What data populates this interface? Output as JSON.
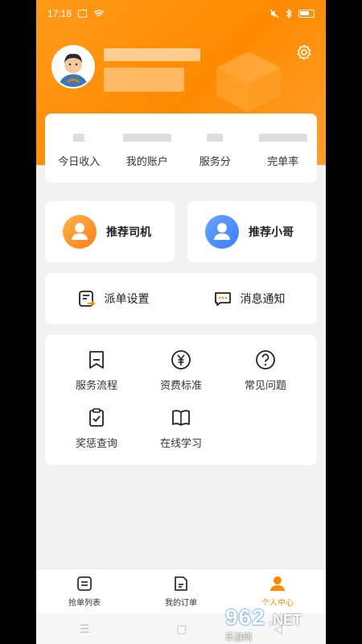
{
  "status_bar": {
    "time": "17:18"
  },
  "profile": {
    "settings_icon": "gear-icon"
  },
  "stats": [
    {
      "label": "今日收入"
    },
    {
      "label": "我的账户"
    },
    {
      "label": "服务分"
    },
    {
      "label": "完单率"
    }
  ],
  "recommend": [
    {
      "label": "推荐司机",
      "icon": "driver-icon"
    },
    {
      "label": "推荐小哥",
      "icon": "courier-icon"
    }
  ],
  "quick": [
    {
      "label": "派单设置",
      "icon": "dispatch-settings-icon"
    },
    {
      "label": "消息通知",
      "icon": "message-icon"
    }
  ],
  "services": [
    {
      "label": "服务流程",
      "icon": "bookmark-icon"
    },
    {
      "label": "资费标准",
      "icon": "yen-icon"
    },
    {
      "label": "常见问题",
      "icon": "question-icon"
    },
    {
      "label": "奖惩查询",
      "icon": "clipboard-check-icon"
    },
    {
      "label": "在线学习",
      "icon": "book-icon"
    }
  ],
  "tabs": [
    {
      "label": "抢单列表",
      "icon": "list-icon",
      "active": false
    },
    {
      "label": "我的订单",
      "icon": "order-icon",
      "active": false
    },
    {
      "label": "个人中心",
      "icon": "person-icon",
      "active": true
    }
  ],
  "watermark": {
    "logo": "962",
    "suffix": ".NET",
    "sub": "乐游网"
  },
  "colors": {
    "accent": "#ff8a00",
    "hero": "#ff9a1a",
    "background": "#f2f2f2"
  }
}
